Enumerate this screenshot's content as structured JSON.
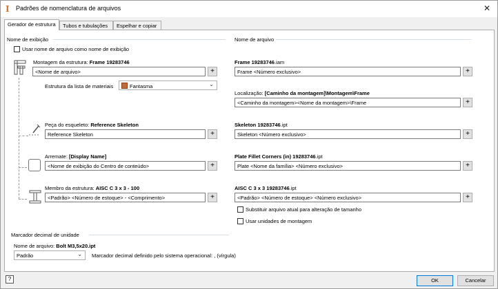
{
  "window": {
    "title": "Padrões de nomenclatura de arquivos",
    "close": "✕"
  },
  "tabs": [
    "Gerador de estrutura",
    "Tubos e tubulações",
    "Espelhar e copiar"
  ],
  "display_name": {
    "section": "Nome de exibição",
    "use_filename_checkbox": "Usar nome de arquivo como nome de exibição",
    "assembly_label": "Montagem da estrutura: ",
    "assembly_value": "Frame 19283746",
    "assembly_field": "<Nome de arquivo>",
    "bom_label": "Estrutura da lista de materiais",
    "bom_value": "Fantasma",
    "skeleton_label": "Peça do esqueleto: ",
    "skeleton_value": "Reference Skeleton",
    "skeleton_field": "Reference Skeleton",
    "endtreat_label": "Arremate: ",
    "endtreat_value": "[Display Name]",
    "endtreat_field": "<Nome de exibição do Centro de conteúdo>",
    "member_label": "Membro da estrutura: ",
    "member_value": "AISC C 3 x 3 - 100",
    "member_field": "<Padrão> <Número de estoque> - <Comprimento>"
  },
  "file_name": {
    "section": "Nome de arquivo",
    "frame_bold": "Frame 19283746",
    "frame_ext": ".iam",
    "frame_field": "Frame <Número exclusivo>",
    "location_label": "Localização: ",
    "location_value": "[Caminho da montagem]\\Montagem\\Frame",
    "location_field": "<Caminho da montagem><Nome da montagem>\\Frame",
    "skeleton_bold": "Skeleton 19283746",
    "skeleton_ext": ".ipt",
    "skeleton_field": "Skeleton <Número exclusivo>",
    "plate_bold": "Plate Fillet Corners (in) 19283746",
    "plate_ext": ".ipt",
    "plate_field": "Plate <Nome da família> <Número exclusivo>",
    "member_bold": "AISC C 3 x 3 19283746",
    "member_ext": ".ipt",
    "member_field": "<Padrão> <Número de estoque> <Número exclusivo>",
    "replace_checkbox": "Substituir arquivo atual para alteração de tamanho",
    "units_checkbox": "Usar unidades de montagem"
  },
  "decimal": {
    "section": "Marcador decimal de unidade",
    "filename_label": "Nome de arquivo: ",
    "filename_value": "Bolt M3,5x20.ipt",
    "combo_value": "Padrão",
    "os_marker_text": "Marcador decimal definido pelo sistema operacional: , (vírgula)"
  },
  "buttons": {
    "ok": "OK",
    "cancel": "Cancelar",
    "plus": "+",
    "help": "?"
  }
}
